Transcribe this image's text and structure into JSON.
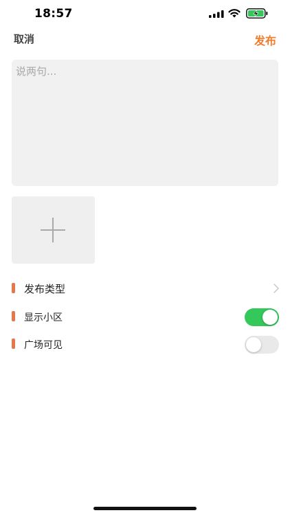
{
  "status_bar": {
    "time": "18:57"
  },
  "nav": {
    "cancel_label": "取消",
    "publish_label": "发布"
  },
  "composer": {
    "placeholder": "说两句...",
    "value": ""
  },
  "options": [
    {
      "label": "发布类型",
      "control": "chevron"
    },
    {
      "label": "显示小区",
      "control": "toggle",
      "on": true
    },
    {
      "label": "广场可见",
      "control": "toggle",
      "on": false
    }
  ],
  "colors": {
    "accent": "#f07c2e",
    "marker": "#e5774a",
    "toggle_on": "#34c759",
    "toggle_off": "#e9e9ea",
    "input_bg": "#f1f1f1"
  }
}
